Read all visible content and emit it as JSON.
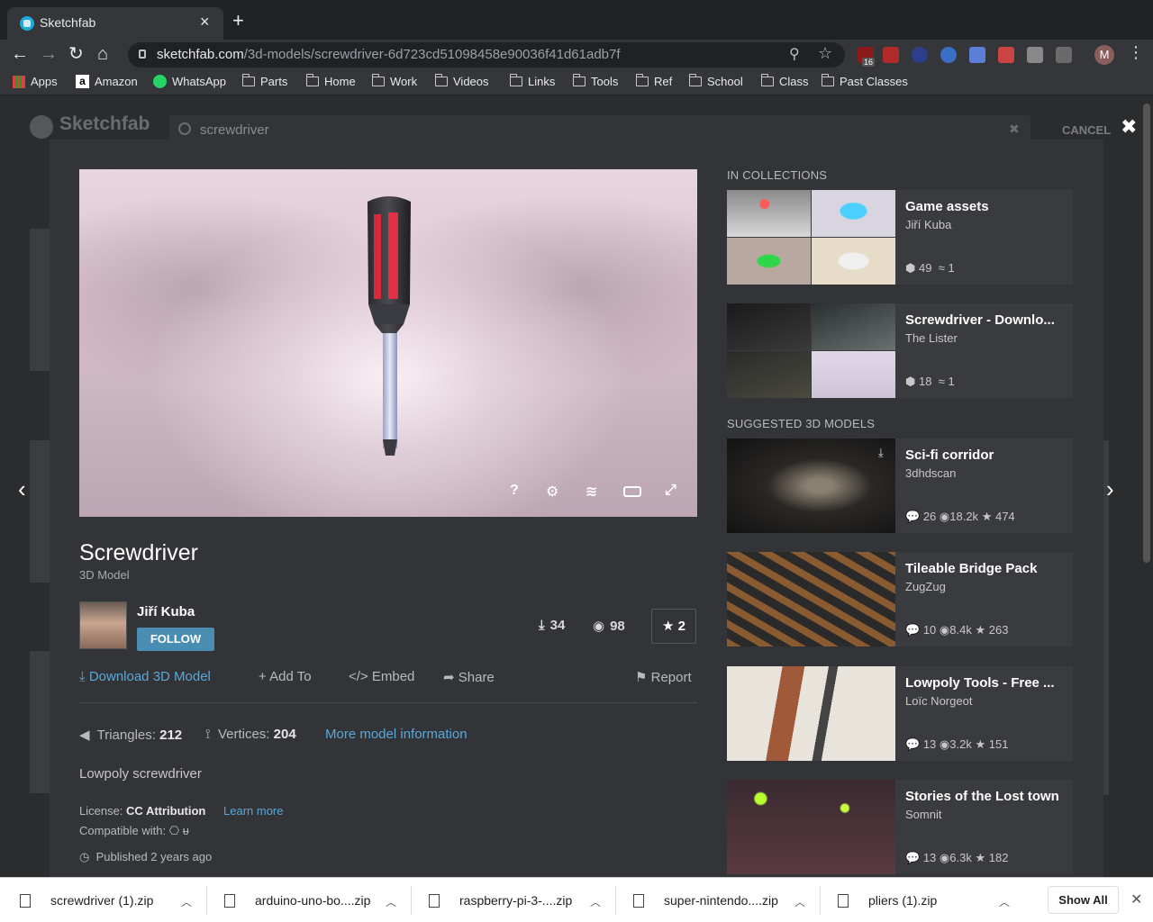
{
  "browser": {
    "tab_title": "Sketchfab",
    "url_domain": "sketchfab.com",
    "url_path": "/3d-models/screwdriver-6d723cd51098458e90036f41d61adb7f",
    "extension_badge": "16",
    "profile_initial": "M",
    "bookmarks": [
      "Apps",
      "Amazon",
      "WhatsApp",
      "Parts",
      "Home",
      "Work",
      "Videos",
      "Links",
      "Tools",
      "Ref",
      "School",
      "Class",
      "Past Classes"
    ]
  },
  "background": {
    "logo": "Sketchfab",
    "search_value": "screwdriver",
    "cancel": "CANCEL"
  },
  "model": {
    "title": "Screwdriver",
    "type": "3D Model",
    "author": "Jiří Kuba",
    "follow": "FOLLOW",
    "downloads": "34",
    "views": "98",
    "likes": "2",
    "actions": {
      "download": "Download 3D Model",
      "add_to": "Add To",
      "embed": "Embed",
      "share": "Share",
      "report": "Report"
    },
    "triangles_label": "Triangles:",
    "triangles": "212",
    "vertices_label": "Vertices:",
    "vertices": "204",
    "more_info": "More model information",
    "description": "Lowpoly screwdriver",
    "license_label": "License:",
    "license": "CC Attribution",
    "learn_more": "Learn more",
    "compatible": "Compatible with:",
    "published": "Published 2 years ago"
  },
  "viewer_controls": {
    "help": "?",
    "settings": "settings-icon",
    "layers": "layers-icon",
    "vr": "vr-icon",
    "fullscreen": "fullscreen-icon"
  },
  "sidebar": {
    "collections_heading": "IN COLLECTIONS",
    "collections": [
      {
        "name": "Game assets",
        "owner": "Jiří Kuba",
        "models": "49",
        "followers": "1"
      },
      {
        "name": "Screwdriver - Downlo...",
        "owner": "The Lister",
        "models": "18",
        "followers": "1"
      }
    ],
    "suggested_heading": "SUGGESTED 3D MODELS",
    "suggested": [
      {
        "name": "Sci-fi corridor",
        "owner": "3dhdscan",
        "comments": "26",
        "views": "18.2k",
        "likes": "474"
      },
      {
        "name": "Tileable Bridge Pack",
        "owner": "ZugZug",
        "comments": "10",
        "views": "8.4k",
        "likes": "263"
      },
      {
        "name": "Lowpoly Tools - Free ...",
        "owner": "Loïc Norgeot",
        "comments": "13",
        "views": "3.2k",
        "likes": "151"
      },
      {
        "name": "Stories of the Lost town",
        "owner": "Somnit",
        "comments": "13",
        "views": "6.3k",
        "likes": "182"
      }
    ]
  },
  "downloads_bar": {
    "files": [
      "screwdriver (1).zip",
      "arduino-uno-bo....zip",
      "raspberry-pi-3-....zip",
      "super-nintendo....zip",
      "pliers (1).zip"
    ],
    "show_all": "Show All"
  },
  "colors": {
    "accent": "#5aa8d8",
    "follow_bg": "#4a8db3",
    "modal_bg": "#333437",
    "handle_red": "#d8283c"
  }
}
